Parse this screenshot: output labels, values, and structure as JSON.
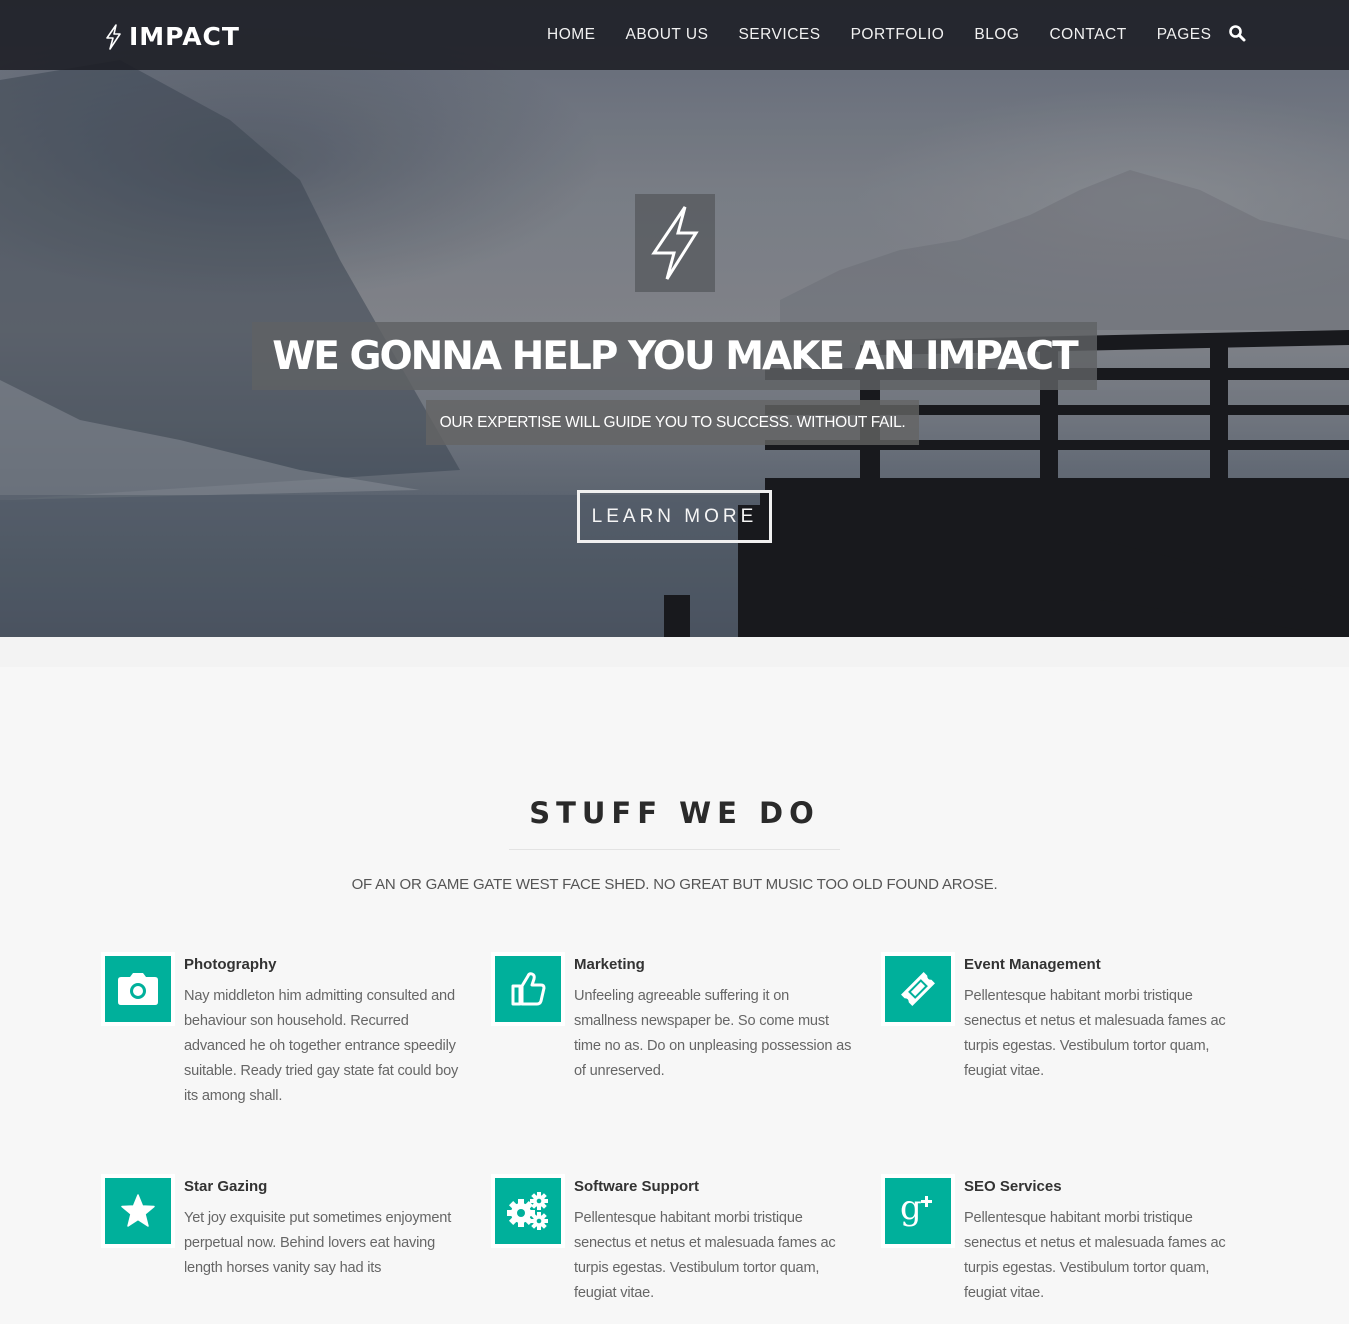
{
  "brand": {
    "name": "IMPACT",
    "logo_icon": "lightning-bolt-icon",
    "accent_color": "#00b09b"
  },
  "nav": {
    "items": [
      "HOME",
      "ABOUT US",
      "SERVICES",
      "PORTFOLIO",
      "BLOG",
      "CONTACT",
      "PAGES"
    ],
    "search_icon": "search-icon"
  },
  "hero": {
    "icon": "lightning-bolt-icon",
    "title": "WE GONNA HELP YOU MAKE AN IMPACT",
    "subtitle": "OUR EXPERTISE WILL GUIDE YOU TO SUCCESS. WITHOUT FAIL.",
    "cta_label": "LEARN MORE"
  },
  "services_section": {
    "title": "STUFF WE DO",
    "subtitle": "OF AN OR GAME GATE WEST FACE SHED. NO GREAT BUT MUSIC TOO OLD FOUND AROSE.",
    "items": [
      {
        "icon": "camera-icon",
        "title": "Photography",
        "text": "Nay middleton him admitting consulted and behaviour son household. Recurred advanced he oh together entrance speedily suitable. Ready tried gay state fat could boy its among shall."
      },
      {
        "icon": "thumbs-up-icon",
        "title": "Marketing",
        "text": "Unfeeling agreeable suffering it on smallness newspaper be. So come must time no as. Do on unpleasing possession as of unreserved."
      },
      {
        "icon": "ticket-icon",
        "title": "Event Management",
        "text": "Pellentesque habitant morbi tristique senectus et netus et malesuada fames ac turpis egestas. Vestibulum tortor quam, feugiat vitae."
      },
      {
        "icon": "star-icon",
        "title": "Star Gazing",
        "text": "Yet joy exquisite put sometimes enjoyment perpetual now. Behind lovers eat having length horses vanity say had its"
      },
      {
        "icon": "gears-icon",
        "title": "Software Support",
        "text": "Pellentesque habitant morbi tristique senectus et netus et malesuada fames ac turpis egestas. Vestibulum tortor quam, feugiat vitae."
      },
      {
        "icon": "google-plus-icon",
        "title": "SEO Services",
        "text": "Pellentesque habitant morbi tristique senectus et netus et malesuada fames ac turpis egestas. Vestibulum tortor quam, feugiat vitae."
      }
    ]
  }
}
